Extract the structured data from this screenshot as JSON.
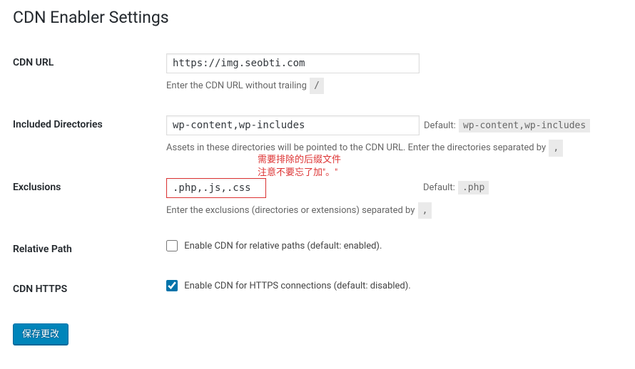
{
  "page_title": "CDN Enabler Settings",
  "fields": {
    "cdn_url": {
      "label": "CDN URL",
      "value": "https://img.seobti.com",
      "description_prefix": "Enter the CDN URL without trailing ",
      "description_code": "/"
    },
    "included_dirs": {
      "label": "Included Directories",
      "value": "wp-content,wp-includes",
      "default_label": "Default: ",
      "default_code": "wp-content,wp-includes",
      "description_prefix": "Assets in these directories will be pointed to the CDN URL. Enter the directories separated by ",
      "description_code": ","
    },
    "exclusions": {
      "label": "Exclusions",
      "value": ".php,.js,.css",
      "default_label": "Default: ",
      "default_code": ".php",
      "description_prefix": "Enter the exclusions (directories or extensions) separated by ",
      "description_code": ",",
      "annotation_line1": "需要排除的后缀文件",
      "annotation_line2": "注意不要忘了加\"。\""
    },
    "relative_path": {
      "label": "Relative Path",
      "checkbox_label": "Enable CDN for relative paths (default: enabled).",
      "checked": false
    },
    "cdn_https": {
      "label": "CDN HTTPS",
      "checkbox_label": "Enable CDN for HTTPS connections (default: disabled).",
      "checked": true
    }
  },
  "submit_button": "保存更改"
}
